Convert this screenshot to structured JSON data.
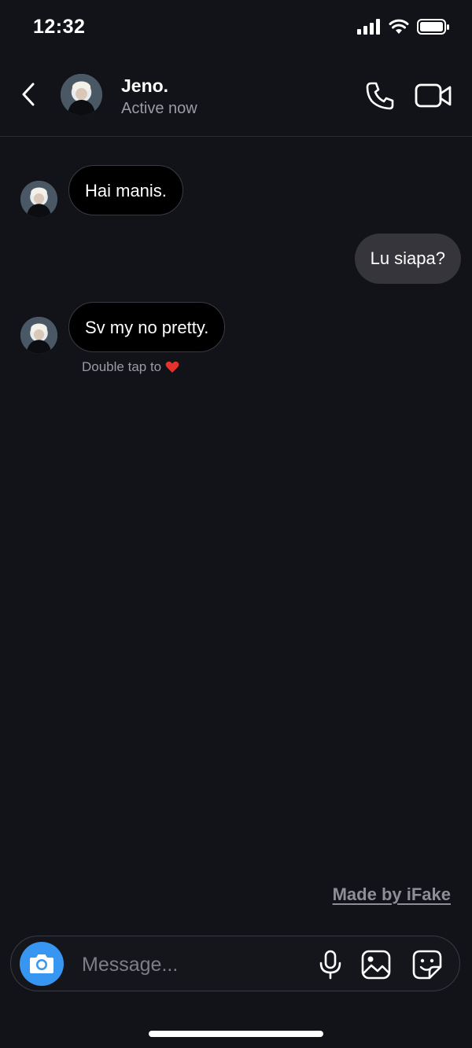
{
  "status_bar": {
    "time": "12:32",
    "icons": [
      "cellular-signal-icon",
      "wifi-icon",
      "battery-icon"
    ]
  },
  "header": {
    "contact_name": "Jeno.",
    "status": "Active now",
    "icons": [
      "back-chevron-icon",
      "phone-icon",
      "video-camera-icon"
    ]
  },
  "messages": [
    {
      "direction": "incoming",
      "text": "Hai manis."
    },
    {
      "direction": "outgoing",
      "text": "Lu siapa?"
    },
    {
      "direction": "incoming",
      "text": "Sv my no pretty."
    }
  ],
  "hint": {
    "text": "Double tap to",
    "icon": "heart-icon",
    "icon_color": "#e5322d"
  },
  "watermark": "Made by iFake",
  "composer": {
    "placeholder": "Message...",
    "icons": [
      "camera-icon",
      "microphone-icon",
      "gallery-icon",
      "sticker-icon"
    ],
    "camera_color": "#3796f2"
  },
  "colors": {
    "background": "#121319",
    "incoming_bubble": "#000000",
    "outgoing_bubble": "#35353b"
  }
}
